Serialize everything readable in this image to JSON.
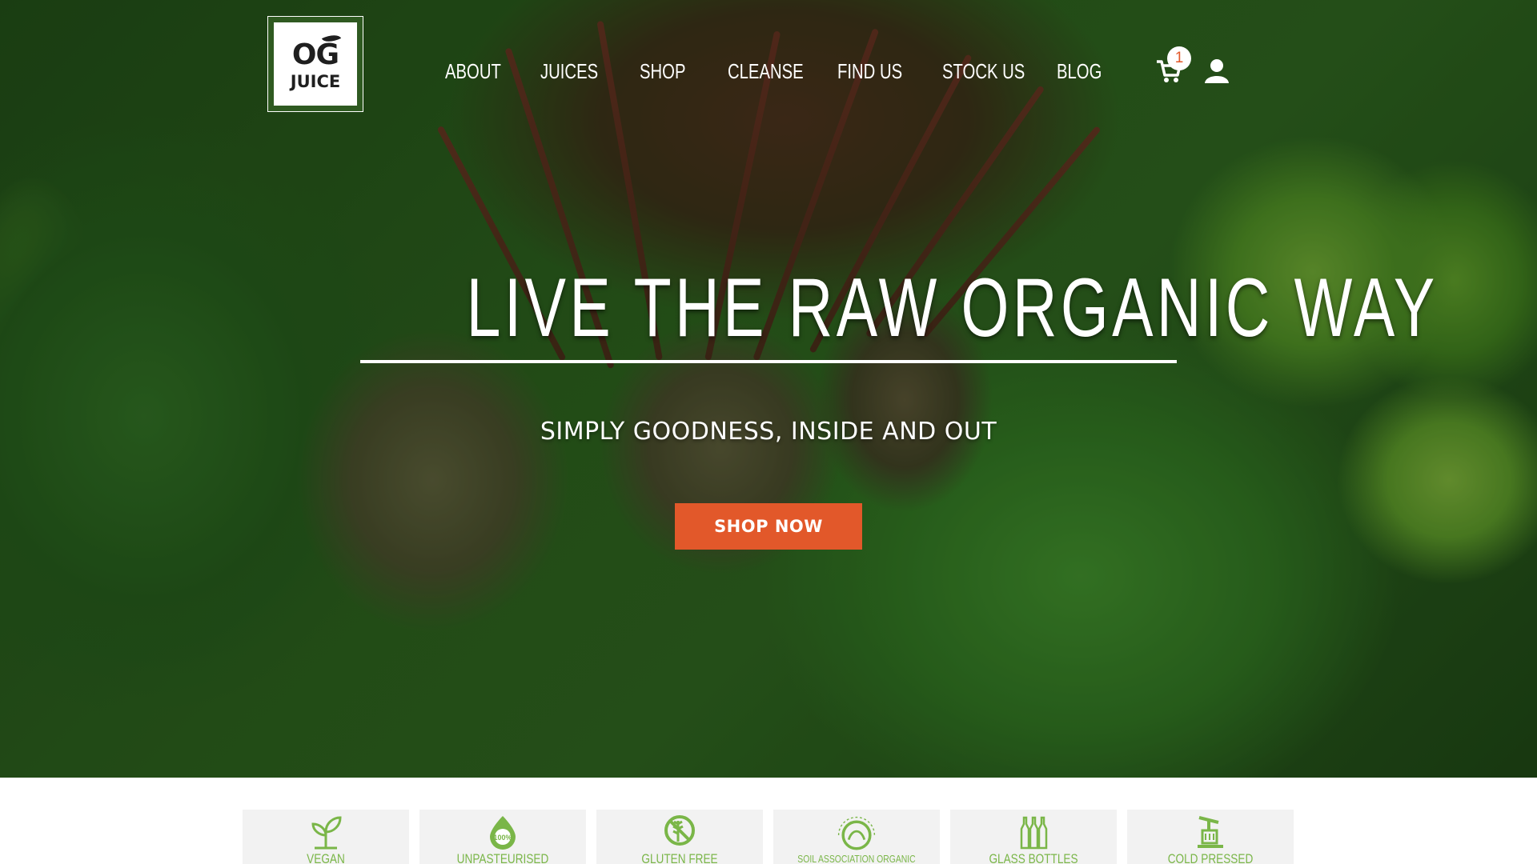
{
  "brand": {
    "logo_line1": "OG",
    "logo_line2": "JUICE"
  },
  "nav": {
    "items": [
      {
        "label": "ABOUT"
      },
      {
        "label": "JUICES"
      },
      {
        "label": "SHOP"
      },
      {
        "label": "CLEANSE"
      },
      {
        "label": "FIND US"
      },
      {
        "label": "STOCK US"
      },
      {
        "label": "BLOG"
      }
    ],
    "cart_count": "1",
    "cart_icon": "cart-icon",
    "account_icon": "user-icon"
  },
  "hero": {
    "headline": "LIVE THE RAW ORGANIC WAY",
    "subheadline": "SIMPLY GOODNESS, INSIDE AND OUT",
    "cta_label": "SHOP NOW"
  },
  "features": {
    "items": [
      {
        "label": "VEGAN",
        "icon": "sprout-icon"
      },
      {
        "label": "UNPASTEURISED",
        "icon": "hundred-percent-icon"
      },
      {
        "label": "GLUTEN FREE",
        "icon": "no-wheat-icon"
      },
      {
        "label": "SOIL ASSOCIATION ORGANIC",
        "icon": "soil-association-icon"
      },
      {
        "label": "GLASS BOTTLES",
        "icon": "bottles-icon"
      },
      {
        "label": "COLD PRESSED",
        "icon": "press-icon"
      }
    ]
  },
  "colors": {
    "accent": "#e2582a",
    "feature_green": "#7ab648",
    "feature_bg": "#f2f2f2",
    "hero_tint": "#2c5e1f"
  }
}
